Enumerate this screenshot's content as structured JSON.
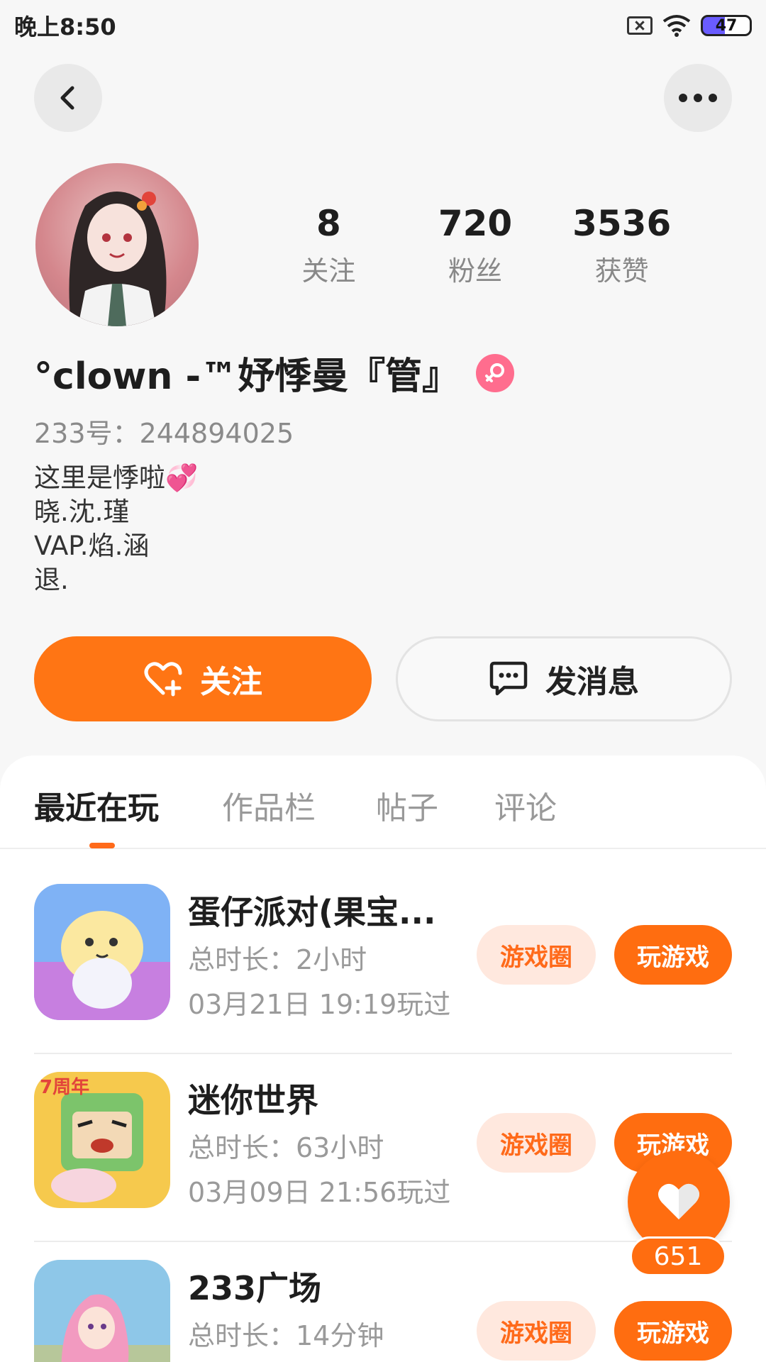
{
  "status_bar": {
    "time": "晚上8:50",
    "battery": "47"
  },
  "profile": {
    "stats": [
      {
        "value": "8",
        "label": "关注"
      },
      {
        "value": "720",
        "label": "粉丝"
      },
      {
        "value": "3536",
        "label": "获赞"
      }
    ],
    "name": "°clown -™妤悸曼『管』",
    "account_id": "233号：244894025",
    "bio": [
      "这里是悸啦💞",
      "晓.沈.瑾",
      "VAP.焰.涵",
      "退."
    ]
  },
  "actions": {
    "follow_label": "关注",
    "message_label": "发消息"
  },
  "tabs": [
    {
      "label": "最近在玩",
      "active": true
    },
    {
      "label": "作品栏",
      "active": false
    },
    {
      "label": "帖子",
      "active": false
    },
    {
      "label": "评论",
      "active": false
    }
  ],
  "games": [
    {
      "title": "蛋仔派对(果宝...",
      "duration": "总时长：2小时",
      "last_played": "03月21日 19:19玩过",
      "circle_label": "游戏圈",
      "play_label": "玩游戏"
    },
    {
      "title": "迷你世界",
      "duration": "总时长：63小时",
      "last_played": "03月09日 21:56玩过",
      "circle_label": "游戏圈",
      "play_label": "玩游戏"
    },
    {
      "title": "233广场",
      "duration": "总时长：14分钟",
      "last_played": "",
      "circle_label": "游戏圈",
      "play_label": "玩游戏"
    }
  ],
  "floating_like": {
    "count": "651"
  },
  "colors": {
    "accent": "#ff6d10",
    "gender": "#ff6d8e"
  }
}
